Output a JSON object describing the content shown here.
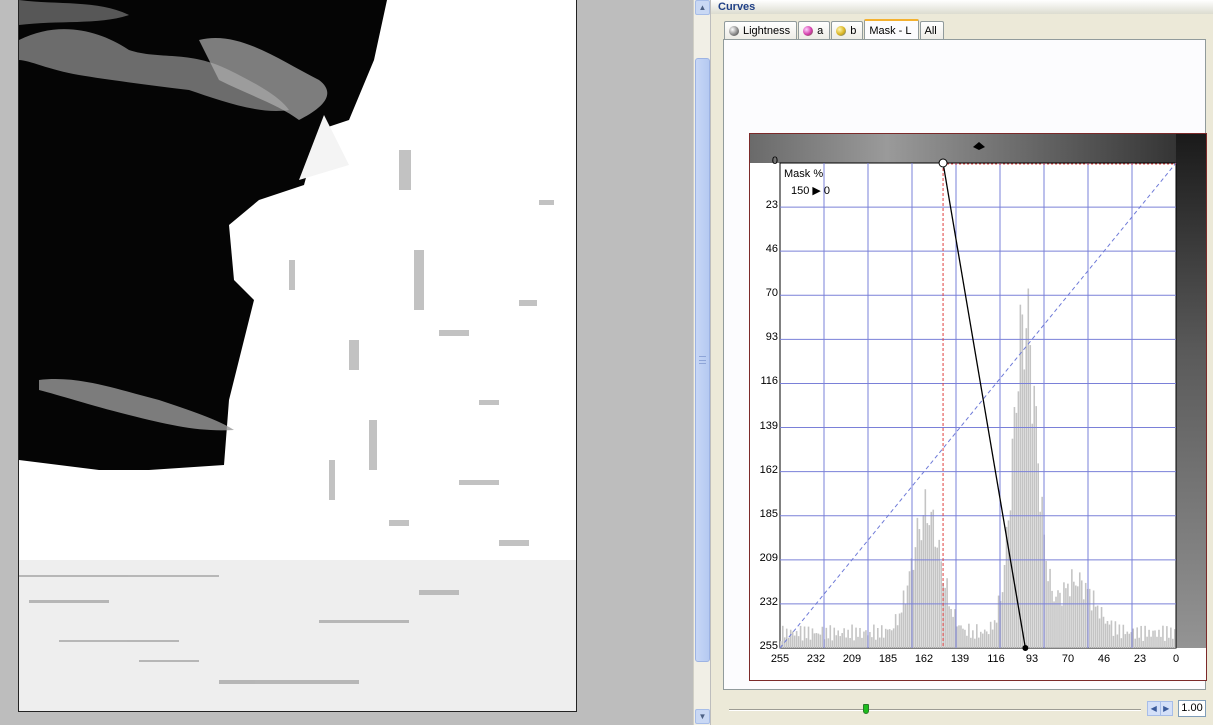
{
  "panel": {
    "title": "Curves"
  },
  "tabs": [
    {
      "label": "Lightness",
      "icon": "lightness-icon",
      "active": false
    },
    {
      "label": "a",
      "icon": "a-channel-icon",
      "active": false
    },
    {
      "label": "b",
      "icon": "b-channel-icon",
      "active": false
    },
    {
      "label": "Mask - L",
      "icon": "",
      "active": true
    },
    {
      "label": "All",
      "icon": "",
      "active": false
    }
  ],
  "graph": {
    "mask_label": "Mask %",
    "mask_value": "150 ▶ 0",
    "y_ticks": [
      "0",
      "23",
      "46",
      "70",
      "93",
      "116",
      "139",
      "162",
      "185",
      "209",
      "232",
      "255"
    ],
    "x_ticks": [
      "255",
      "232",
      "209",
      "185",
      "162",
      "139",
      "116",
      "93",
      "70",
      "46",
      "23",
      "0"
    ],
    "curve_points": [
      {
        "input": 150,
        "output": 0
      },
      {
        "input": 97,
        "output": 255
      }
    ],
    "guide_line_input": 150,
    "colors": {
      "grid": "#7a80d8",
      "histogram": "#c4c4c4",
      "curve": "#000000",
      "guide": "#e04040",
      "diagonal": "#6f7bd8"
    }
  },
  "zoom": {
    "value": "1.00"
  }
}
